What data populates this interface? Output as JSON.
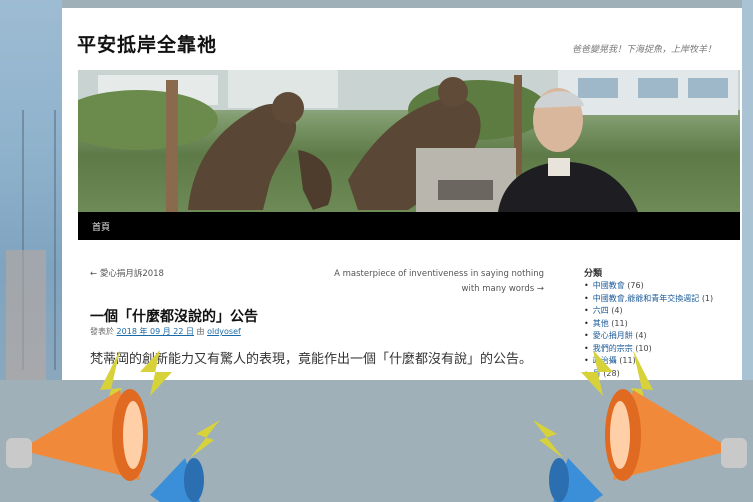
{
  "site": {
    "title": "平安抵岸全靠祂",
    "description": "爸爸變晃我！下海捉魚，上岸牧羊！"
  },
  "nav": {
    "home": "首頁"
  },
  "post_nav": {
    "prev": "← 愛心捐月訴2018",
    "next": "A masterpiece of inventiveness in saying nothing with many words →"
  },
  "post": {
    "title": "一個「什麼都沒說的」公告",
    "meta_prefix": "發表於",
    "date": "2018 年 09 月 22 日",
    "meta_by": "由",
    "author": "oldyosef",
    "body": "梵蒂岡的創新能力又有驚人的表現，竟能作出一個「什麼都沒有說」的公告。"
  },
  "sidebar": {
    "title": "分類",
    "categories": [
      {
        "label": "中國教會",
        "count": "(76)"
      },
      {
        "label": "中國教會,爺爺和青年交換週記",
        "count": "(1)"
      },
      {
        "label": "六四",
        "count": "(4)"
      },
      {
        "label": "其他",
        "count": "(11)"
      },
      {
        "label": "愛心捐月餅",
        "count": "(4)"
      },
      {
        "label": "我們的宗宗",
        "count": "(10)"
      },
      {
        "label": "政治攝",
        "count": "(11)"
      },
      {
        "label": "月",
        "count": "(28)"
      }
    ]
  },
  "colors": {
    "megaphone_orange": "#f08a3a",
    "megaphone_blue": "#3a8fd8",
    "lightning": "#d8d23a",
    "background": "#9fb0b8"
  }
}
